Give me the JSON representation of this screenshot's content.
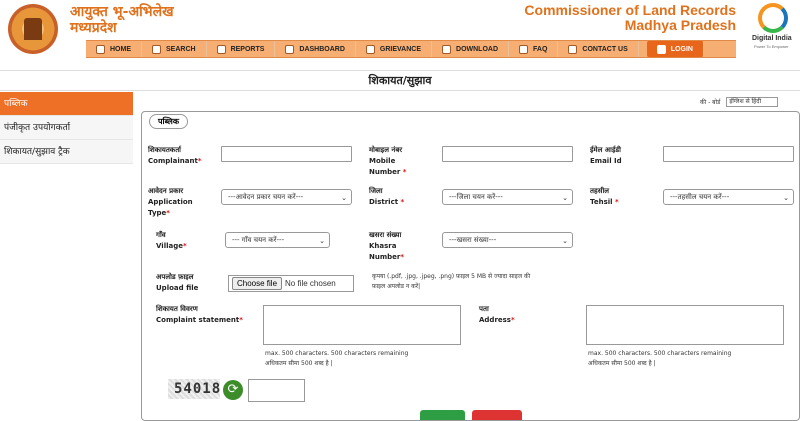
{
  "header": {
    "hi_line1": "आयुक्त भू-अभिलेख",
    "hi_line2": "मध्यप्रदेश",
    "en_line1": "Commissioner of Land Records",
    "en_line2": "Madhya Pradesh",
    "digital_india": "Digital India",
    "digital_india_sub": "Power To Empower"
  },
  "nav": [
    "HOME",
    "SEARCH",
    "REPORTS",
    "DASHBOARD",
    "GRIEVANCE",
    "DOWNLOAD",
    "FAQ",
    "CONTACT US"
  ],
  "nav_login": "LOGIN",
  "page_title": "शिकायत/सुझाव",
  "sidebar": [
    "पब्लिक",
    "पंजीकृत उपयोगकर्ता",
    "शिकायत/सुझाव ट्रैक"
  ],
  "lang": {
    "label": "की - बोर्ड",
    "value": "इंग्लिश से हिंदी"
  },
  "legend": "पब्लिक",
  "form": {
    "complainant": {
      "hi": "शिकायतकर्ता",
      "en": "Complainant"
    },
    "mobile": {
      "hi": "मोबाइल नंबर",
      "en1": "Mobile",
      "en2": "Number"
    },
    "email": {
      "hi": "ईमेल आईडी",
      "en": "Email Id"
    },
    "app_type": {
      "hi": "आवेदन प्रकार",
      "en1": "Application",
      "en2": "Type",
      "placeholder": "---आवेदन प्रकार चयन करें---"
    },
    "district": {
      "hi": "जिला",
      "en": "District",
      "placeholder": "---जिला चयन करें---"
    },
    "tehsil": {
      "hi": "तहसील",
      "en": "Tehsil",
      "placeholder": "---तहसील चयन करें---"
    },
    "village": {
      "hi": "गाँव",
      "en": "Village",
      "placeholder": "--- गाँव चयन करें---"
    },
    "khasra": {
      "hi": "खसरा संख्या",
      "en1": "Khasra",
      "en2": "Number",
      "placeholder": "---खसरा संख्या---"
    },
    "upload": {
      "hi": "अपलोड फ़ाइल",
      "en": "Upload file",
      "button": "Choose file",
      "status": "No file chosen",
      "note1": "कृपया (.pdf, .jpg, .jpeg, .png) फ़ाइल 5 MB से ज्यादा साइज की",
      "note2": "फ़ाइल अपलोड न करें|"
    },
    "statement": {
      "hi": "शिकायत विवरण",
      "en": "Complaint statement",
      "note1": "max. 500 characters. 500 characters remaining",
      "note2": "अधिकतम सीमा 500 शब्द है |"
    },
    "address": {
      "hi": "पता",
      "en": "Address",
      "note1": "max. 500 characters. 500 characters remaining",
      "note2": "अधिकतम सीमा 500 शब्द है |"
    },
    "captcha": "54018"
  }
}
